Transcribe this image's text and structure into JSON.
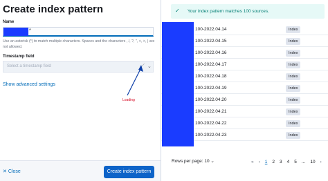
{
  "flyout": {
    "title": "Create index pattern",
    "name_label": "Name",
    "name_value_suffix": "*",
    "help_text": "Use an asterisk (*) to match multiple characters. Spaces and the characters , /, ?, \", <, >, | are not allowed.",
    "timestamp_label": "Timestamp field",
    "timestamp_placeholder": "Select a timestamp field",
    "advanced_link": "Show advanced settings",
    "annotation": "Loading",
    "close_label": "Close",
    "create_label": "Create index pattern"
  },
  "results": {
    "callout": "Your index pattern matches 100 sources.",
    "rows": [
      {
        "name": "100-2022.04.14",
        "badge": "Index"
      },
      {
        "name": "100-2022.04.15",
        "badge": "Index"
      },
      {
        "name": "100-2022.04.16",
        "badge": "Index"
      },
      {
        "name": "100-2022.04.17",
        "badge": "Index"
      },
      {
        "name": "100-2022.04.18",
        "badge": "Index"
      },
      {
        "name": "100-2022.04.19",
        "badge": "Index"
      },
      {
        "name": "100-2022.04.20",
        "badge": "Index"
      },
      {
        "name": "100-2022.04.21",
        "badge": "Index"
      },
      {
        "name": "100-2022.04.22",
        "badge": "Index"
      },
      {
        "name": "100-2022.04.23",
        "badge": "Index"
      }
    ],
    "rows_per_page": "Rows per page: 10",
    "pages": [
      "1",
      "2",
      "3",
      "4",
      "5",
      "...",
      "10"
    ],
    "current_page": "1"
  },
  "colors": {
    "accent": "#006bb8",
    "primary_button": "#0d63c8",
    "success": "#017d73",
    "redaction": "#1a3cff",
    "annotation": "#d6001c"
  }
}
